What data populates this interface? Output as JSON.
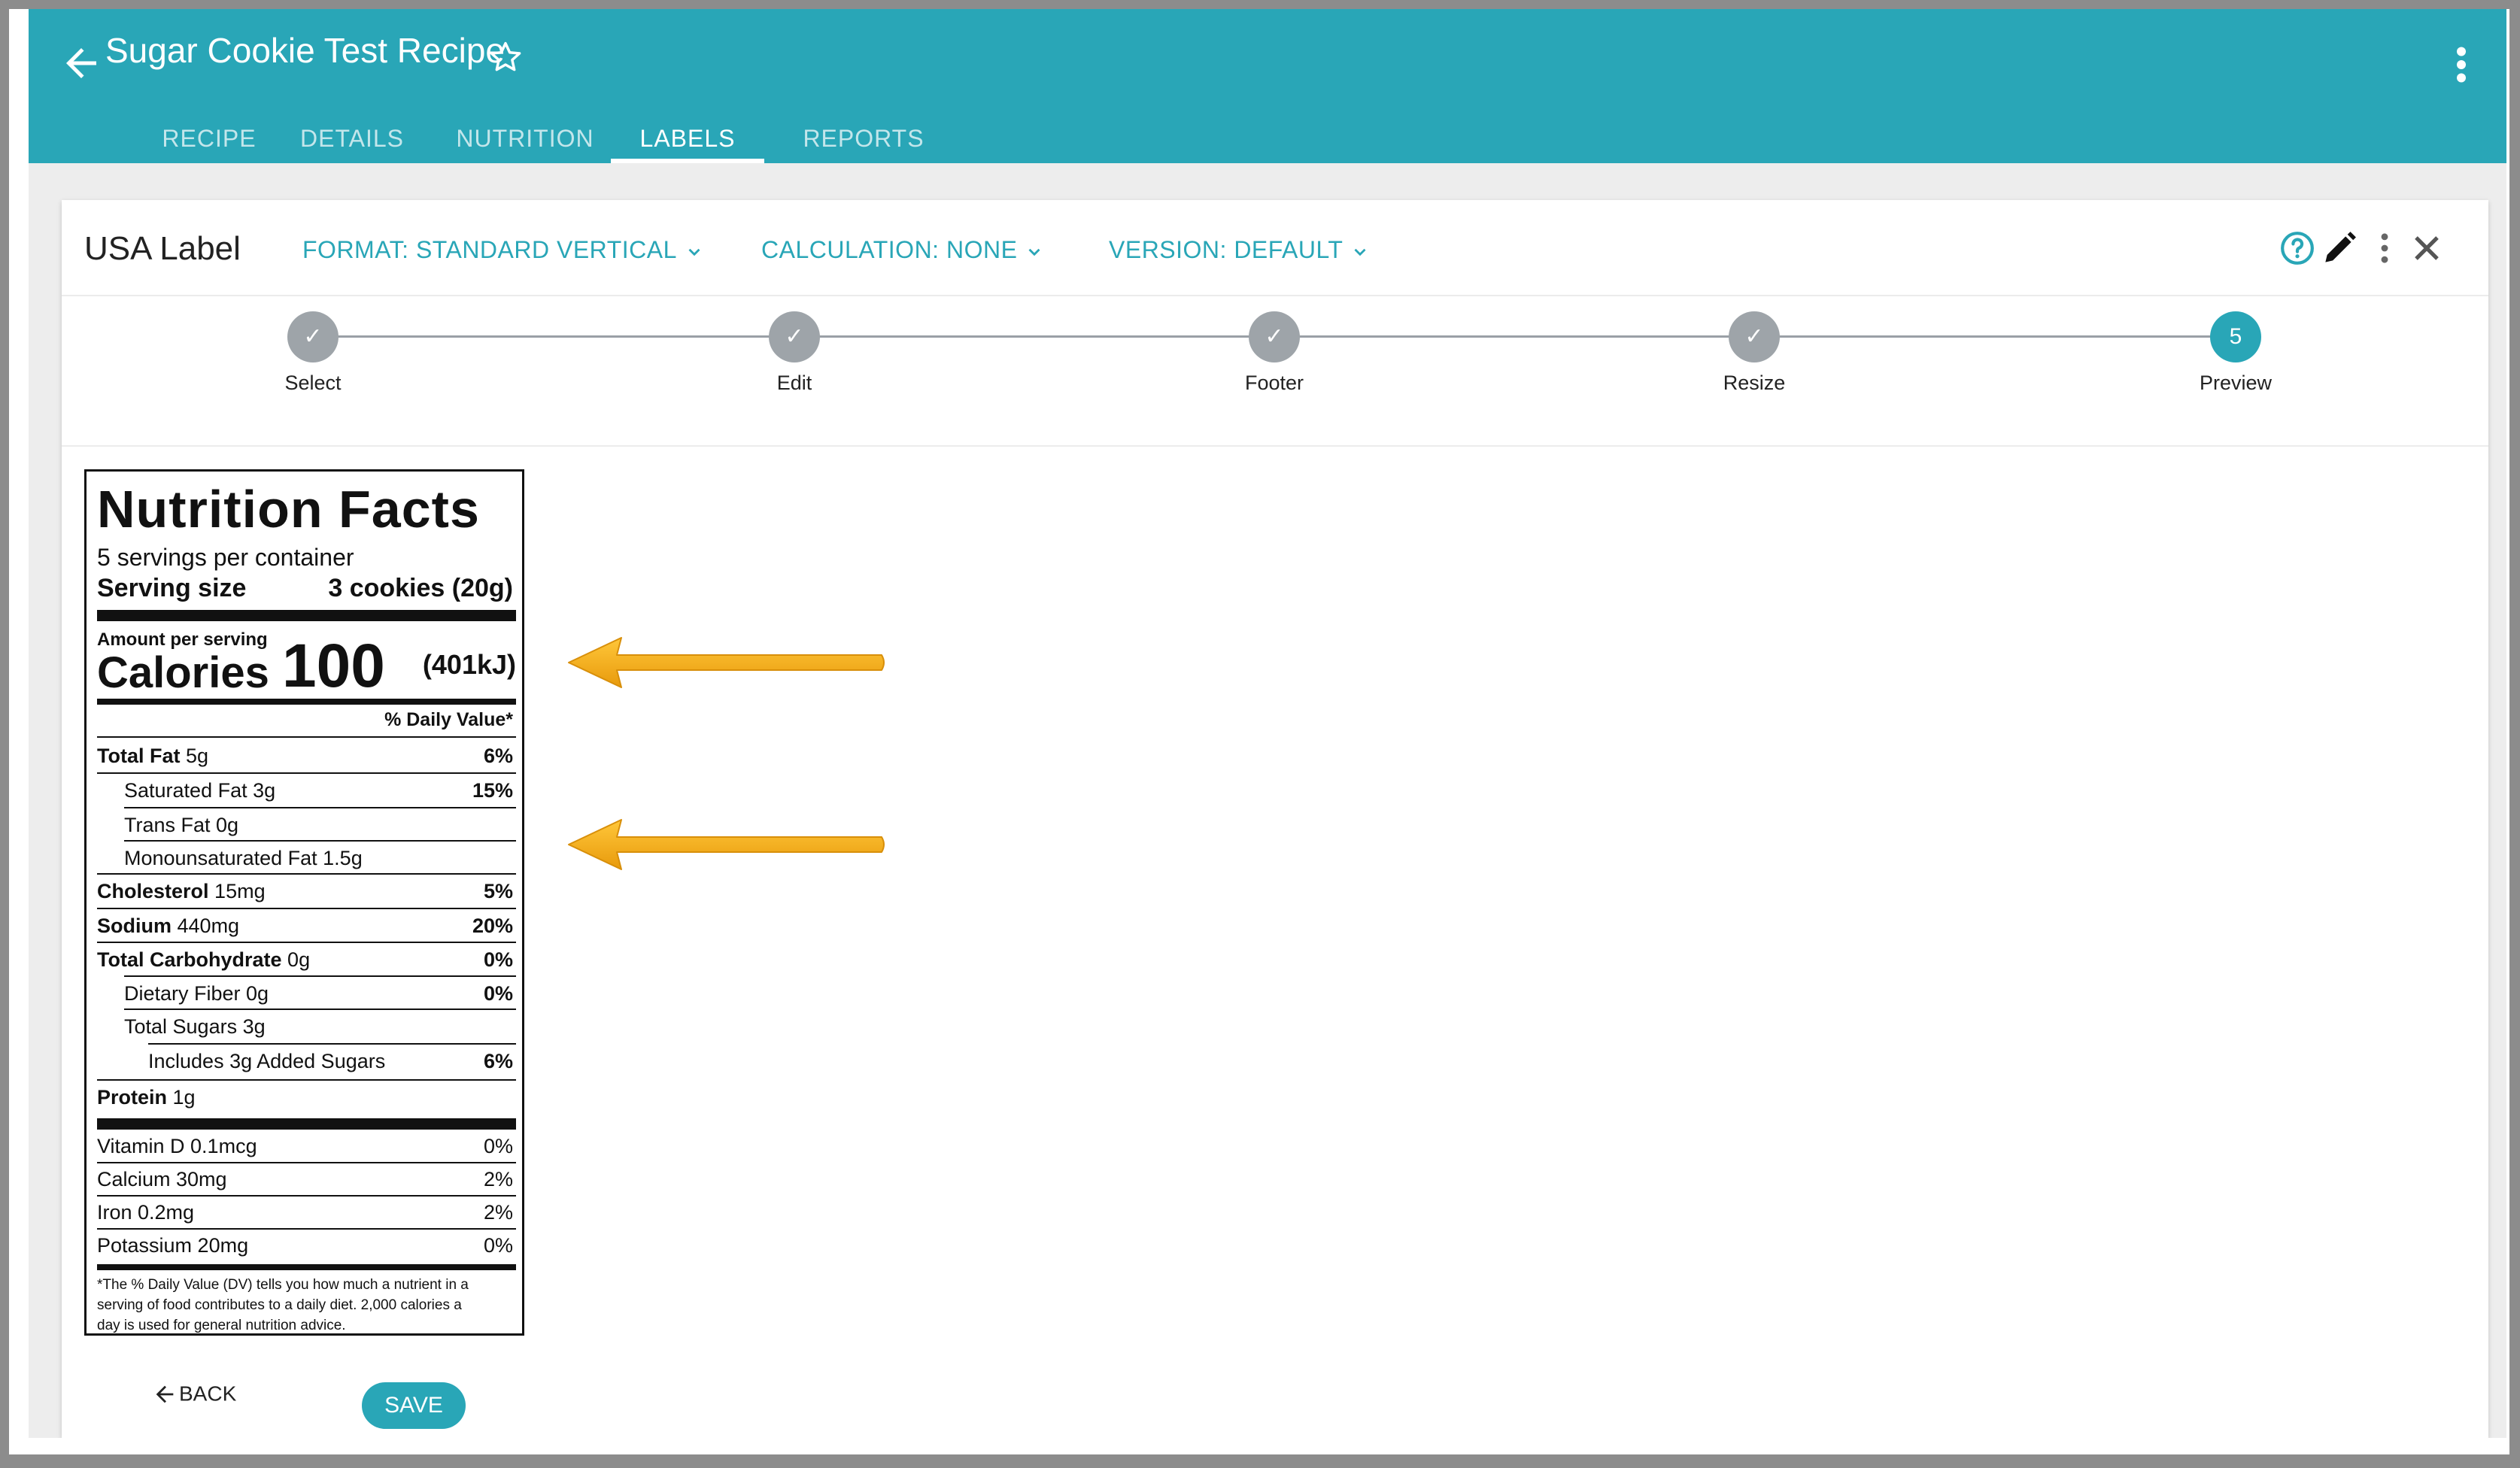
{
  "app": {
    "title": "Sugar Cookie Test Recipe"
  },
  "tabs": [
    {
      "label": "RECIPE",
      "active": false
    },
    {
      "label": "DETAILS",
      "active": false
    },
    {
      "label": "NUTRITION",
      "active": false
    },
    {
      "label": "LABELS",
      "active": true
    },
    {
      "label": "REPORTS",
      "active": false
    }
  ],
  "card": {
    "title": "USA Label",
    "format_label": "FORMAT: STANDARD VERTICAL",
    "calculation_label": "CALCULATION: NONE",
    "version_label": "VERSION: DEFAULT"
  },
  "stepper": {
    "steps": [
      {
        "label": "Select",
        "marker": "✓",
        "state": "done"
      },
      {
        "label": "Edit",
        "marker": "✓",
        "state": "done"
      },
      {
        "label": "Footer",
        "marker": "✓",
        "state": "done"
      },
      {
        "label": "Resize",
        "marker": "✓",
        "state": "done"
      },
      {
        "label": "Preview",
        "marker": "5",
        "state": "current"
      }
    ]
  },
  "label": {
    "title": "Nutrition Facts",
    "servings": "5 servings per container",
    "serving_size_label": "Serving size",
    "serving_size_value": "3 cookies (20g)",
    "amount_per_serving": "Amount per serving",
    "calories_label": "Calories",
    "calories_value": "100",
    "kj": "(401kJ)",
    "daily_value_header": "% Daily Value*",
    "rows": {
      "total_fat": {
        "name": "Total Fat",
        "amount": "5g",
        "dv": "6%"
      },
      "saturated_fat": {
        "name": "Saturated Fat 3g",
        "dv": "15%"
      },
      "trans_fat": {
        "name": "Trans Fat 0g"
      },
      "mono_fat": {
        "name": "Monounsaturated Fat 1.5g"
      },
      "cholesterol": {
        "name": "Cholesterol",
        "amount": "15mg",
        "dv": "5%"
      },
      "sodium": {
        "name": "Sodium",
        "amount": "440mg",
        "dv": "20%"
      },
      "total_carb": {
        "name": "Total Carbohydrate",
        "amount": "0g",
        "dv": "0%"
      },
      "fiber": {
        "name": "Dietary Fiber 0g",
        "dv": "0%"
      },
      "sugars": {
        "name": "Total Sugars 3g"
      },
      "added_sugars": {
        "name": "Includes 3g Added Sugars",
        "dv": "6%"
      },
      "protein": {
        "name": "Protein",
        "amount": "1g"
      }
    },
    "vitamins": [
      {
        "name": "Vitamin D 0.1mcg",
        "dv": "0%"
      },
      {
        "name": "Calcium 30mg",
        "dv": "2%"
      },
      {
        "name": "Iron 0.2mg",
        "dv": "2%"
      },
      {
        "name": "Potassium 20mg",
        "dv": "0%"
      }
    ],
    "footnote_lines": [
      "*The % Daily Value (DV) tells you how much a nutrient in a",
      "serving of food contributes to a daily diet. 2,000 calories a",
      "day is used for general nutrition advice."
    ]
  },
  "actions": {
    "back_label": "BACK",
    "save_label": "SAVE"
  },
  "colors": {
    "primary": "#29a6b7",
    "step_done": "#9ea4a9",
    "arrow": "#f2ad1a"
  }
}
